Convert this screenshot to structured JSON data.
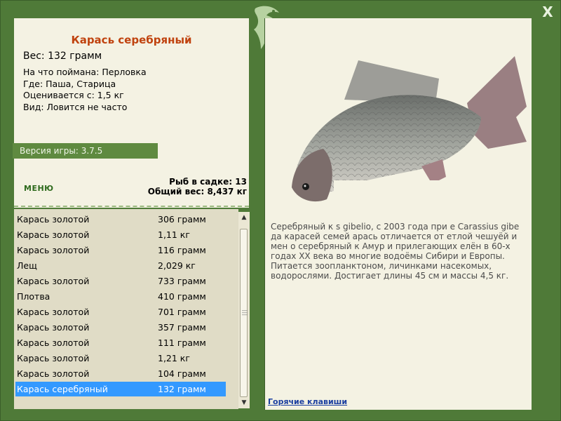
{
  "header": {
    "close_label": "X"
  },
  "fish_card": {
    "title": "Карась серебряный",
    "weight": "Вес: 132 грамм",
    "details": [
      "На что поймана: Перловка",
      "Где: Паша, Старица",
      "Оценивается с: 1,5 кг",
      "Вид: Ловится не часто"
    ]
  },
  "version": "Версия игры: 3.7.5",
  "menu_label": "МЕНЮ",
  "cage": {
    "count": "Рыб в садке: 13",
    "total": "Общий вес: 8,437 кг"
  },
  "fish_list": [
    {
      "name": "Карась золотой",
      "weight": "306 грамм"
    },
    {
      "name": "Карась золотой",
      "weight": "1,11 кг"
    },
    {
      "name": "Карась золотой",
      "weight": "116 грамм"
    },
    {
      "name": "Лещ",
      "weight": "2,029 кг"
    },
    {
      "name": "Карась золотой",
      "weight": "733 грамм"
    },
    {
      "name": "Плотва",
      "weight": "410 грамм"
    },
    {
      "name": "Карась золотой",
      "weight": "701 грамм"
    },
    {
      "name": "Карась золотой",
      "weight": "357 грамм"
    },
    {
      "name": "Карась золотой",
      "weight": "111 грамм"
    },
    {
      "name": "Карась золотой",
      "weight": "1,21 кг"
    },
    {
      "name": "Карась золотой",
      "weight": "104 грамм"
    },
    {
      "name": "Карась серебряный",
      "weight": "132 грамм",
      "selected": true
    }
  ],
  "description": "Серебряный к                              s gibelio, с 2003 года при                                 е Carassius gibe                              да карасей семей                              арась отличается от                             етлой чешуёй и мен                                о серебряный к                              Амур и прилегающих                              елён в 60-х годах XX века во многие водоёмы Сибири и Европы. Питается зоопланктоном, личинками насекомых, водорослями. Достигает длины 45 см и массы 4,5 кг.",
  "hotkeys_label": "Горячие клавиши",
  "colors": {
    "frame": "#4f7a38",
    "panel": "#f4f2e3",
    "title": "#c0430f",
    "selected": "#3399ff",
    "link": "#1b3fa0"
  }
}
